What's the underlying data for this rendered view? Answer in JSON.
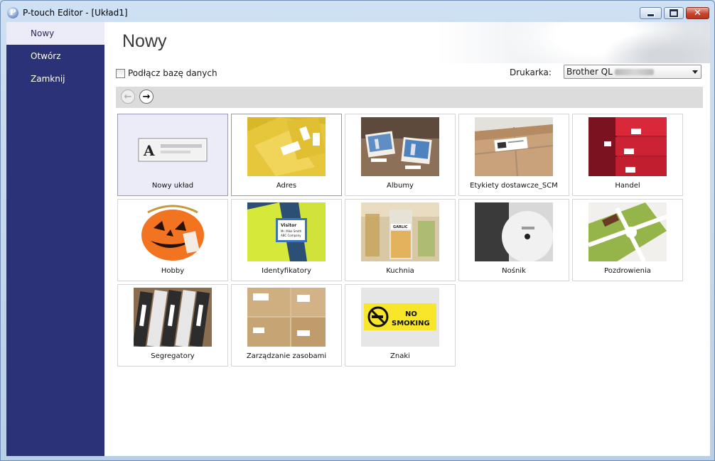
{
  "window": {
    "title": "P-touch Editor - [Układ1]",
    "app_icon_glyph": "P",
    "close_glyph": "✕"
  },
  "sidebar": {
    "items": [
      {
        "label": "Nowy",
        "active": true
      },
      {
        "label": "Otwórz",
        "active": false
      },
      {
        "label": "Zamknij",
        "active": false
      }
    ]
  },
  "main": {
    "title": "Nowy",
    "connect_db_label": "Podłącz bazę danych",
    "connect_db_checked": false,
    "printer_label": "Drukarka:",
    "printer_value": "Brother QL",
    "nav": {
      "back_glyph": "←",
      "forward_glyph": "→"
    }
  },
  "templates": [
    {
      "label": "Nowy układ",
      "icon": "new-layout-icon",
      "selected": true
    },
    {
      "label": "Adres",
      "icon": "envelopes-photo"
    },
    {
      "label": "Albumy",
      "icon": "album-photo"
    },
    {
      "label": "Etykiety dostawcze_SCM",
      "icon": "parcel-photo"
    },
    {
      "label": "Handel",
      "icon": "shelf-boxes-photo"
    },
    {
      "label": "Hobby",
      "icon": "pumpkin-photo"
    },
    {
      "label": "Identyfikatory",
      "icon": "visitor-badge-photo",
      "badge_lines": [
        "Visitor",
        "Mr. Mike Smith",
        "ABC Company"
      ]
    },
    {
      "label": "Kuchnia",
      "icon": "jars-photo",
      "jar_text": "GARLIC"
    },
    {
      "label": "Nośnik",
      "icon": "disc-photo"
    },
    {
      "label": "Pozdrowienia",
      "icon": "gift-photo"
    },
    {
      "label": "Segregatory",
      "icon": "binders-photo"
    },
    {
      "label": "Zarządzanie zasobami",
      "icon": "cartons-photo"
    },
    {
      "label": "Znaki",
      "icon": "no-smoking-sign-photo",
      "sign_text": [
        "NO",
        "SMOKING"
      ]
    }
  ],
  "colors": {
    "sidebar": "#2b3278",
    "selected_tile": "#ecebf8",
    "nav_bar": "#dcdcdc"
  }
}
